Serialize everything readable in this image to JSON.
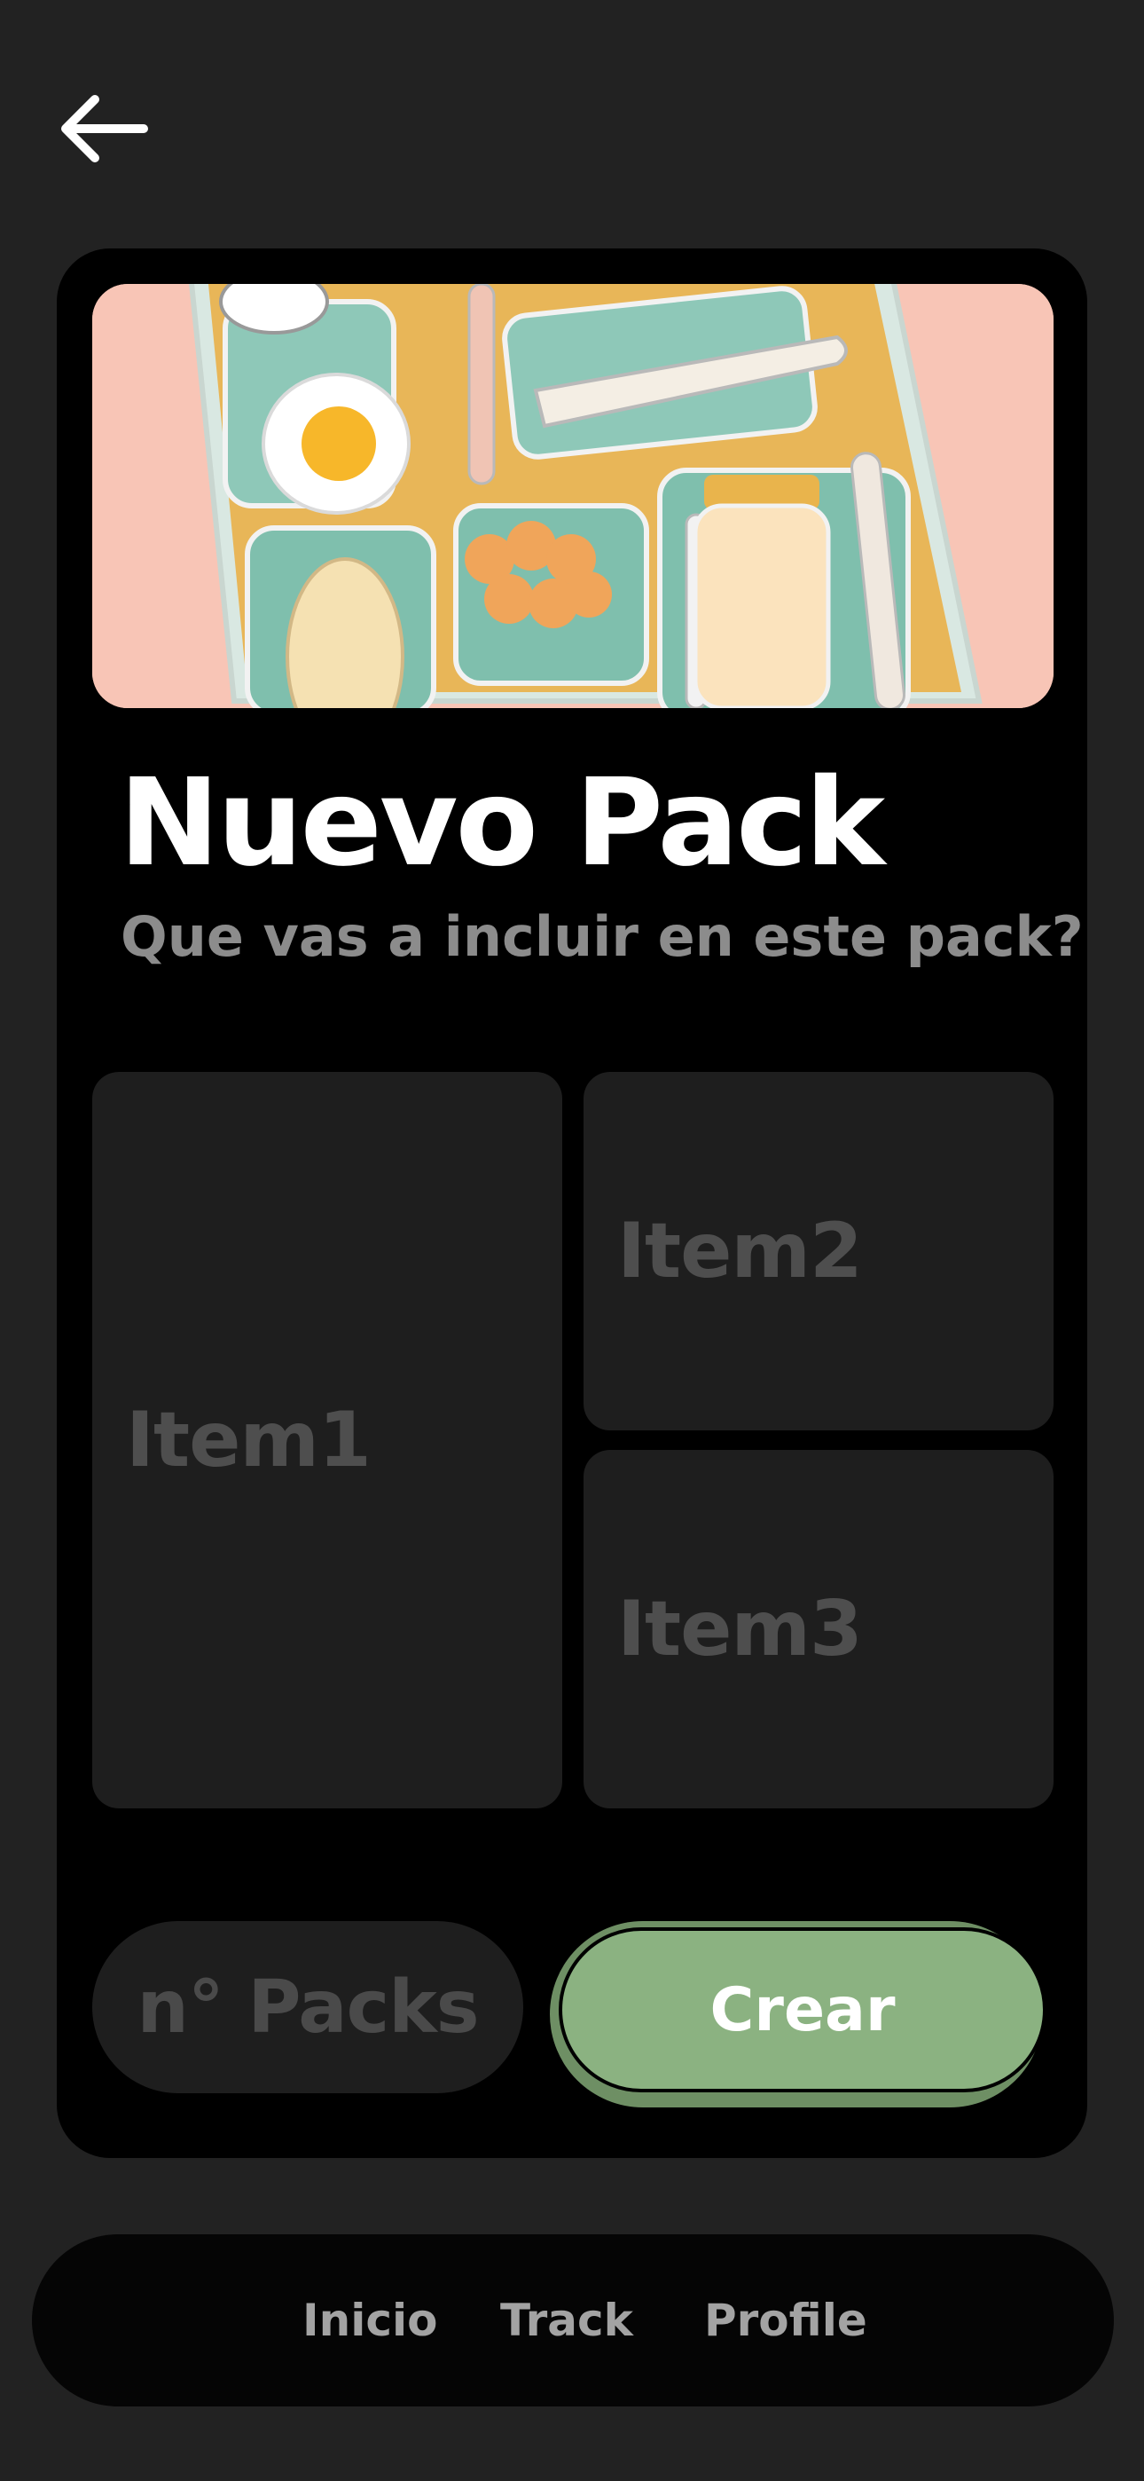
{
  "header": {
    "back_icon": "arrow-left-icon"
  },
  "card": {
    "hero_image": "lunch-tray-illustration",
    "title": "Nuevo Pack",
    "subtitle": "Que vas a incluir en este pack?",
    "items": [
      {
        "label": "Item1"
      },
      {
        "label": "Item2"
      },
      {
        "label": "Item3"
      }
    ],
    "packs_placeholder": "n° Packs",
    "create_label": "Crear"
  },
  "nav": {
    "items": [
      {
        "label": "Inicio"
      },
      {
        "label": "Track"
      },
      {
        "label": "Profile"
      }
    ]
  },
  "colors": {
    "background": "#222222",
    "card": "#000000",
    "tile": "#1e1e1e",
    "accent": "#8bb281"
  }
}
